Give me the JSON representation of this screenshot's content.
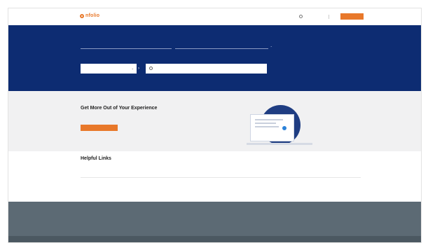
{
  "header": {
    "logo_text": "nfolio",
    "logo_sub": "",
    "lang_label": "",
    "sign_in_label": ""
  },
  "hero": {
    "selector_a": "",
    "selector_b": "",
    "dropdown_value": "",
    "search_placeholder": ""
  },
  "promo": {
    "title": "Get More Out of Your Experience",
    "text": "",
    "button_label": ""
  },
  "links": {
    "title": "Helpful Links",
    "items": [
      "",
      "",
      "",
      "",
      ""
    ]
  },
  "footer": {
    "nav": [
      "",
      "",
      ""
    ],
    "right_nav": [
      "",
      ""
    ],
    "line1": "",
    "line2": "",
    "line3": "",
    "right_label": "",
    "copyright": ""
  },
  "colors": {
    "brand": "#e8782a",
    "hero_bg": "#0d2c72",
    "footer_bg": "#5c6a74"
  }
}
